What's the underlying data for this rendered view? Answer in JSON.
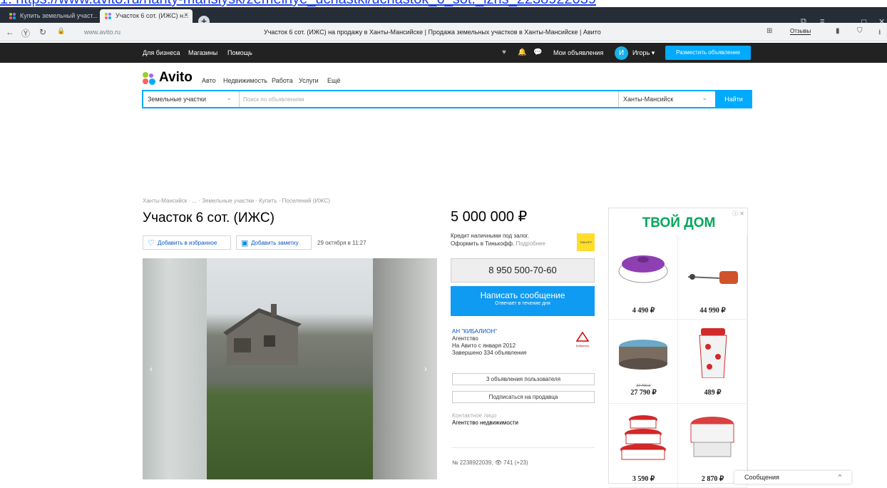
{
  "url_fragment": "1. https://www.avito.ru/hanty-mansiysk/zemelnye_uchastki/uchastok_6_sot._izhs_2238922039",
  "browser": {
    "tabs": [
      {
        "label": "Купить земельный участ..."
      },
      {
        "label": "Участок 6 сот. (ИЖС) н..."
      }
    ],
    "tab_close": "×",
    "new_tab": "+",
    "host": "www.avito.ru",
    "page_title": "Участок 6 сот. (ИЖС) на продажу в Ханты-Мансийске | Продажа земельных участков в Ханты-Мансийске | Авито",
    "reviews_label": "Отзывы"
  },
  "topnav": {
    "links": [
      "Для бизнеса",
      "Магазины",
      "Помощь"
    ],
    "my_ads": "Мои объявления",
    "avatar_letter": "И",
    "user": "Игорь",
    "post_button": "Разместить объявление"
  },
  "logo": {
    "word": "Avito"
  },
  "categories": [
    "Авто",
    "Недвижимость",
    "Работа",
    "Услуги",
    "Ещё"
  ],
  "search": {
    "category": "Земельные участки",
    "placeholder": "Поиск по объявлениям",
    "city": "Ханты-Мансийск",
    "button": "Найти"
  },
  "breadcrumbs": "Ханты-Мансийск · ... · Земельные участки · Купить · Поселений (ИЖС)",
  "listing": {
    "title": "Участок 6 сот. (ИЖС)",
    "favorite": "Добавить в избранное",
    "note": "Добавить заметку",
    "date": "29 октября в 11:27",
    "price": "5 000 000 ₽",
    "credit_line1": "Кредит наличными под залог.",
    "credit_line2": "Оформить в Тинькофф.",
    "credit_more": "Подробнее",
    "phone": "8 950 500-70-60",
    "message_title": "Написать сообщение",
    "message_sub": "Отвечает в течение дня",
    "seller_name": "АН \"КИБАЛИОН\"",
    "seller_type": "Агентство",
    "seller_since": "На Авито с января 2012",
    "seller_done": "Завершено 334 объявления",
    "seller_logo": "Кибалион",
    "user_ads": "3 объявления пользователя",
    "subscribe": "Подписаться на продавца",
    "contact_label": "Контактное лицо",
    "contact_value": "Агентство недвижимости",
    "item_number": "№ 2238922039,",
    "views": "741 (+23)"
  },
  "ad": {
    "brand": "ТВОЙ ДОМ",
    "close": "ⓘ ✕",
    "prices": [
      "4 490 ₽",
      "44 990 ₽",
      "27 790 ₽",
      "489 ₽",
      "3 590 ₽",
      "2 870 ₽"
    ],
    "old_price": "37 790 ₽"
  },
  "chat": {
    "label": "Сообщения"
  },
  "colors": {
    "accent": "#00aaff",
    "topnav": "#222222",
    "message_button": "#0f9bf2",
    "ad_brand": "#00a75a"
  }
}
